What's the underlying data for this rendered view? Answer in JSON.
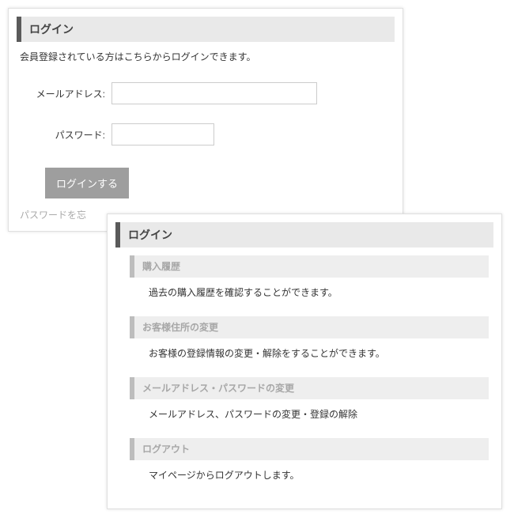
{
  "login_panel": {
    "title": "ログイン",
    "instruction": "会員登録されている方はこちらからログインできます。",
    "email_label": "メールアドレス:",
    "password_label": "パスワード:",
    "email_value": "",
    "password_value": "",
    "login_button": "ログインする",
    "forgot_password": "パスワードを忘"
  },
  "mypage_panel": {
    "title": "ログイン",
    "sections": [
      {
        "heading": "購入履歴",
        "text": "過去の購入履歴を確認することができます。"
      },
      {
        "heading": "お客様住所の変更",
        "text": "お客様の登録情報の変更・解除をすることができます。"
      },
      {
        "heading": "メールアドレス・パスワードの変更",
        "text": "メールアドレス、パスワードの変更・登録の解除"
      },
      {
        "heading": "ログアウト",
        "text": "マイページからログアウトします。"
      }
    ]
  }
}
